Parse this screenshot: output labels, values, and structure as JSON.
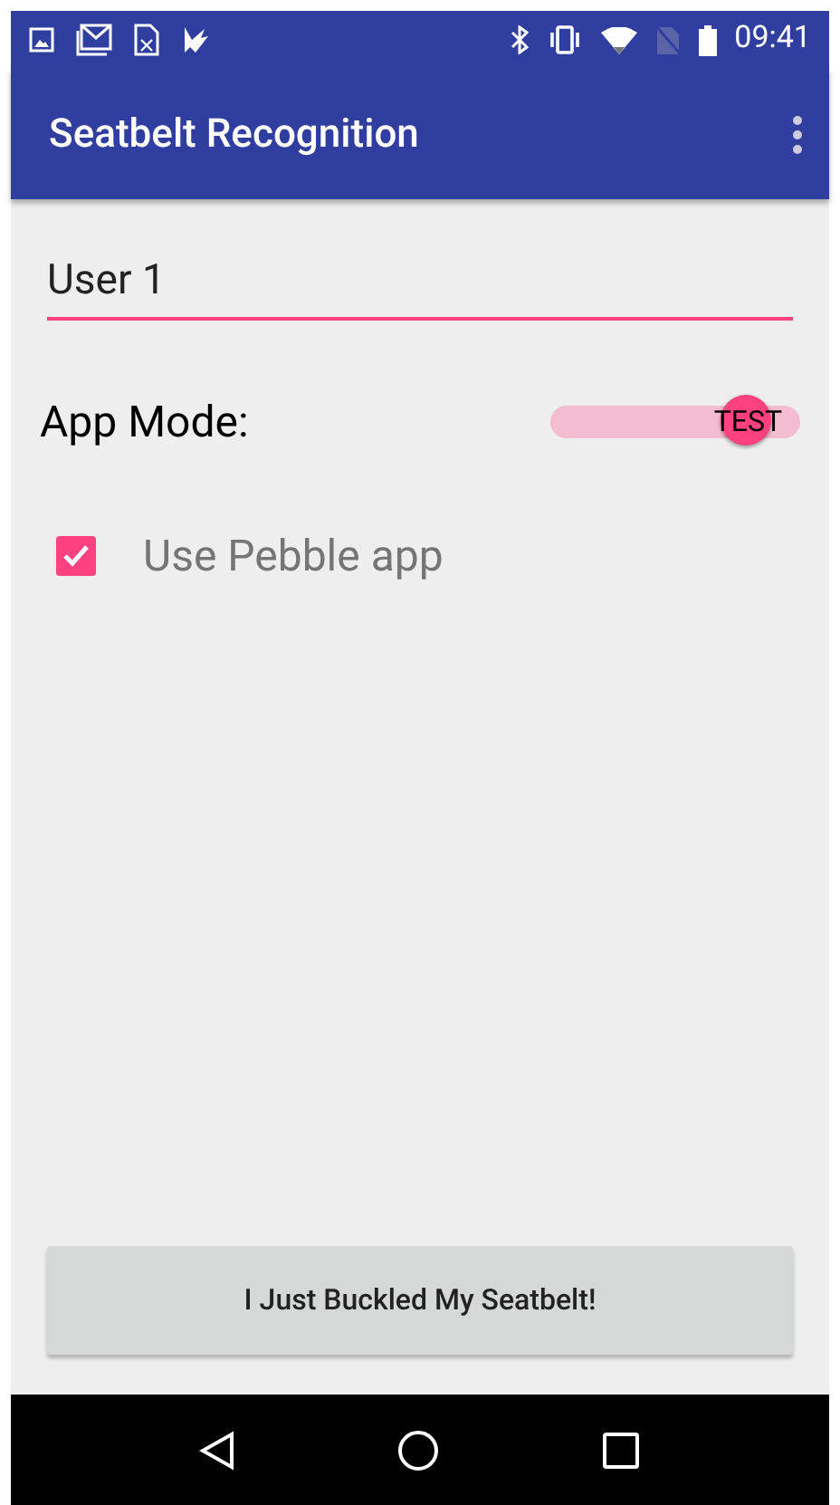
{
  "status_bar": {
    "time": "09:41"
  },
  "app_bar": {
    "title": "Seatbelt Recognition"
  },
  "user_field": {
    "value": "User 1"
  },
  "app_mode": {
    "label": "App Mode:",
    "switch_text": "TEST",
    "on": true
  },
  "pebble_checkbox": {
    "label": "Use Pebble app",
    "checked": true
  },
  "buckle_button": {
    "label": "I Just Buckled My Seatbelt!"
  }
}
